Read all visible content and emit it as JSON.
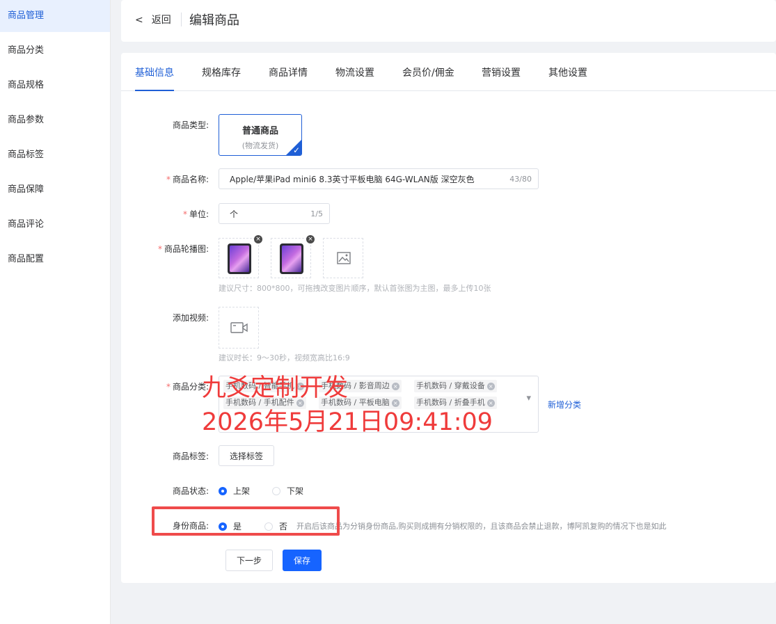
{
  "sidebar": {
    "items": [
      {
        "label": "商品管理"
      },
      {
        "label": "商品分类"
      },
      {
        "label": "商品规格"
      },
      {
        "label": "商品参数"
      },
      {
        "label": "商品标签"
      },
      {
        "label": "商品保障"
      },
      {
        "label": "商品评论"
      },
      {
        "label": "商品配置"
      }
    ]
  },
  "header": {
    "back_label": "返回",
    "title": "编辑商品"
  },
  "tabs": [
    {
      "label": "基础信息"
    },
    {
      "label": "规格库存"
    },
    {
      "label": "商品详情"
    },
    {
      "label": "物流设置"
    },
    {
      "label": "会员价/佣金"
    },
    {
      "label": "营销设置"
    },
    {
      "label": "其他设置"
    }
  ],
  "form": {
    "product_type": {
      "label": "商品类型:",
      "option_title": "普通商品",
      "option_sub": "(物流发货)"
    },
    "product_name": {
      "required": "*",
      "label": "商品名称:",
      "value": "Apple/苹果iPad mini6 8.3英寸平板电脑 64G-WLAN版 深空灰色",
      "count": "43/80"
    },
    "unit": {
      "required": "*",
      "label": "单位:",
      "value": "个",
      "count": "1/5"
    },
    "carousel": {
      "required": "*",
      "label": "商品轮播图:",
      "hint": "建议尺寸：800*800，可拖拽改变图片顺序，默认首张图为主图，最多上传10张",
      "remove": "×"
    },
    "video": {
      "label": "添加视频:",
      "hint": "建议时长：9～30秒，视频宽高比16:9"
    },
    "category": {
      "required": "*",
      "label": "商品分类:",
      "tags": [
        "手机数码 / 智能手机",
        "手机数码 / 影音周边",
        "手机数码 / 穿戴设备",
        "手机数码 / 手机配件",
        "手机数码 / 平板电脑",
        "手机数码 / 折叠手机"
      ],
      "tag_remove": "×",
      "dropdown": "▾",
      "add_link": "新增分类"
    },
    "tags_field": {
      "label": "商品标签:",
      "button": "选择标签"
    },
    "status": {
      "label": "商品状态:",
      "on": "上架",
      "off": "下架"
    },
    "identity": {
      "label": "身份商品:",
      "yes": "是",
      "no": "否",
      "hint": "开启后该商品为分销身份商品,购买则成拥有分销权限的，且该商品会禁止退款，博阿凯复购的情况下也是如此"
    }
  },
  "actions": {
    "next": "下一步",
    "save": "保存"
  },
  "watermark": {
    "line1": "九爻定制开发",
    "line2": "2026年5月21日09:41:09"
  },
  "colors": {
    "accent": "#1f5fd6",
    "primary_button": "#1664ff",
    "watermark": "#ef3b3b",
    "highlight_box": "#ef4b4b"
  }
}
